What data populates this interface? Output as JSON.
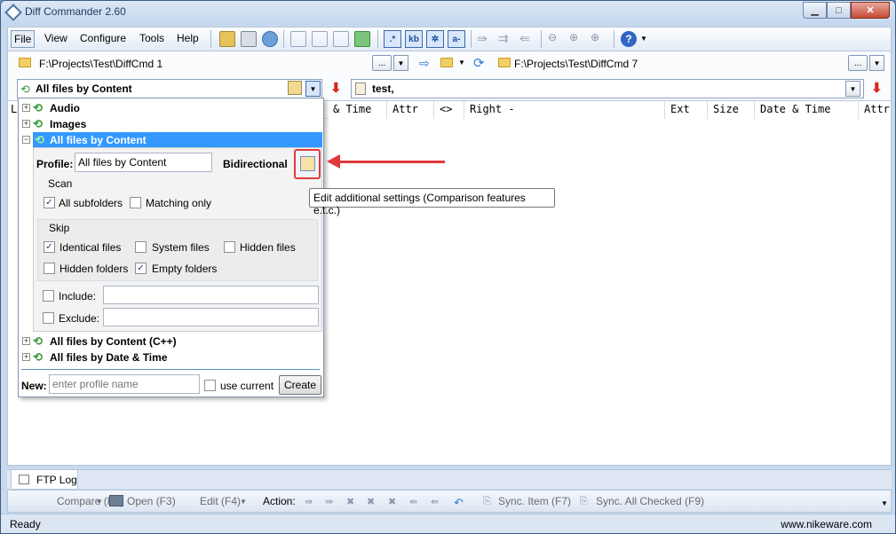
{
  "window": {
    "title": "Diff Commander 2.60"
  },
  "menu": {
    "items": [
      "File",
      "View",
      "Configure",
      "Tools",
      "Help"
    ]
  },
  "toolbar": {
    "regex_label": ".*",
    "kb_label": "kb",
    "case_label": "a-"
  },
  "left_path": {
    "value": "F:\\Projects\\Test\\DiffCmd 1",
    "browse_label": "..."
  },
  "right_path": {
    "value": "F:\\Projects\\Test\\DiffCmd 7",
    "browse_label": "..."
  },
  "profile_combo": {
    "value": "All files by Content"
  },
  "filter": {
    "value": "test,"
  },
  "columns": {
    "left": [
      {
        "label": "L"
      },
      {
        "label": "& Time"
      },
      {
        "label": "Attr"
      },
      {
        "label": "<>"
      }
    ],
    "right": [
      {
        "label": "Right -"
      },
      {
        "label": "Ext"
      },
      {
        "label": "Size"
      },
      {
        "label": "Date & Time"
      },
      {
        "label": "Attr"
      }
    ]
  },
  "dropdown": {
    "profiles": [
      {
        "label": "Audio",
        "expander": "+"
      },
      {
        "label": "Images",
        "expander": "+"
      },
      {
        "label": "All files by Content",
        "expander": "−"
      },
      {
        "label": "All files by Content (C++)",
        "expander": "+"
      },
      {
        "label": "All files by Date & Time",
        "expander": "+"
      }
    ],
    "profile_label": "Profile:",
    "profile_value": "All files by Content",
    "mode_label": "Bidirectional",
    "scan": {
      "title": "Scan",
      "all_subfolders": {
        "label": "All subfolders",
        "checked": true
      },
      "matching_only": {
        "label": "Matching only",
        "checked": false
      }
    },
    "skip": {
      "title": "Skip",
      "identical_files": {
        "label": "Identical files",
        "checked": true
      },
      "system_files": {
        "label": "System files",
        "checked": false
      },
      "hidden_files": {
        "label": "Hidden files",
        "checked": false
      },
      "hidden_folders": {
        "label": "Hidden folders",
        "checked": false
      },
      "empty_folders": {
        "label": "Empty folders",
        "checked": true
      }
    },
    "include": {
      "label": "Include:",
      "value": ""
    },
    "exclude": {
      "label": "Exclude:",
      "value": ""
    },
    "new_label": "New:",
    "new_placeholder": "enter profile name",
    "use_current": "use current",
    "create_label": "Create"
  },
  "tooltip": "Edit additional settings (Comparison features e.t.c.)",
  "bottom_tab": {
    "label": "FTP Log"
  },
  "actionbar": {
    "compare": "Compare (F2)",
    "open": "Open (F3)",
    "edit": "Edit (F4)",
    "action_label": "Action:",
    "sync_item": "Sync. Item (F7)",
    "sync_all": "Sync. All Checked (F9)"
  },
  "status": {
    "left": "Ready",
    "right": "www.nikeware.com"
  },
  "colors": {
    "selection": "#3399ff",
    "highlight": "#e0393b",
    "title_bg": "#c4d7ee"
  }
}
